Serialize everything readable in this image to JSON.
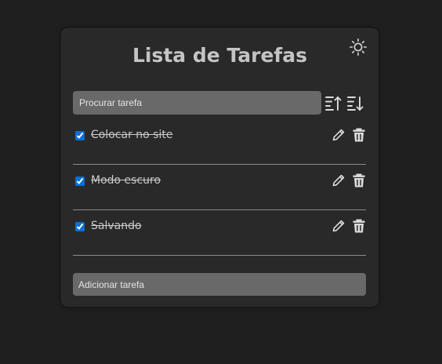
{
  "app": {
    "title": "Lista de Tarefas",
    "theme_icon": "sun-icon"
  },
  "search": {
    "placeholder": "Procurar tarefa"
  },
  "sort": {
    "ascending_icon": "sort-ascending-icon",
    "descending_icon": "sort-descending-icon"
  },
  "tasks": [
    {
      "text": "Colocar no site",
      "done": true
    },
    {
      "text": "Modo escuro",
      "done": true
    },
    {
      "text": "Salvando",
      "done": true
    }
  ],
  "task_icons": {
    "edit": "pencil-icon",
    "delete": "trash-icon"
  },
  "add": {
    "placeholder": "Adicionar tarefa"
  },
  "colors": {
    "background": "#1f1f1f",
    "card": "#292929",
    "input": "#696969",
    "text": "#c4c4c4",
    "checkbox": "#0a6fd6"
  }
}
